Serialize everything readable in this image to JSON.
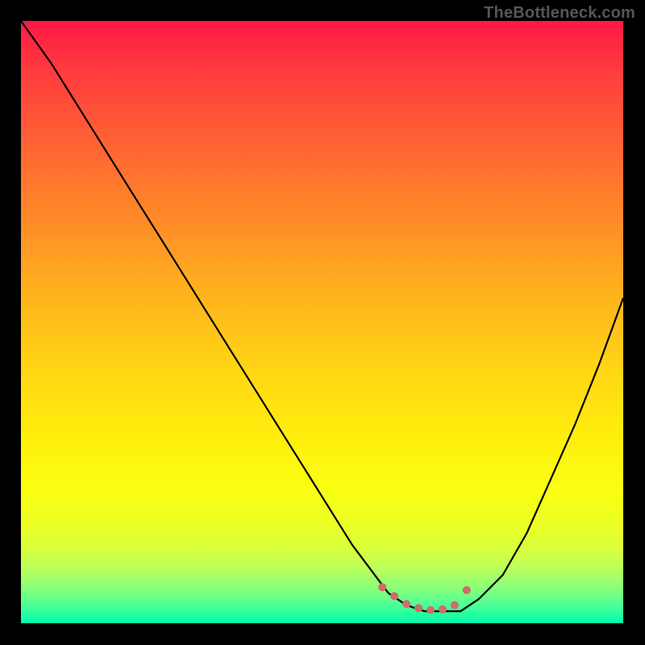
{
  "watermark": {
    "text": "TheBottleneck.com"
  },
  "chart_data": {
    "type": "line",
    "title": "",
    "xlabel": "",
    "ylabel": "",
    "xlim": [
      0,
      100
    ],
    "ylim": [
      0,
      100
    ],
    "grid": false,
    "legend": "none",
    "gradient_colors_top_to_bottom": [
      "#ff1846",
      "#ff6832",
      "#ffb41d",
      "#fff00c",
      "#d7ff40",
      "#00ffaa"
    ],
    "curve_color": "#000000",
    "curve_stroke_w": 2.2,
    "series": [
      {
        "name": "bottleneck-curve",
        "x": [
          0,
          5,
          10,
          15,
          20,
          25,
          30,
          35,
          40,
          45,
          50,
          55,
          58,
          61,
          64,
          67,
          70,
          73,
          76,
          80,
          84,
          88,
          92,
          96,
          100
        ],
        "y": [
          100,
          93,
          85,
          77,
          69,
          61,
          53,
          45,
          37,
          29,
          21,
          13,
          9,
          5,
          3,
          2,
          2,
          2,
          4,
          8,
          15,
          24,
          33,
          43,
          54
        ]
      }
    ],
    "markers": {
      "color": "#d36a6a",
      "radius": 5,
      "points": [
        {
          "x": 60,
          "y": 6
        },
        {
          "x": 62,
          "y": 4.5
        },
        {
          "x": 64,
          "y": 3.2
        },
        {
          "x": 66,
          "y": 2.5
        },
        {
          "x": 68,
          "y": 2.2
        },
        {
          "x": 70,
          "y": 2.3
        },
        {
          "x": 72,
          "y": 3.0
        },
        {
          "x": 74,
          "y": 5.5
        }
      ]
    }
  }
}
